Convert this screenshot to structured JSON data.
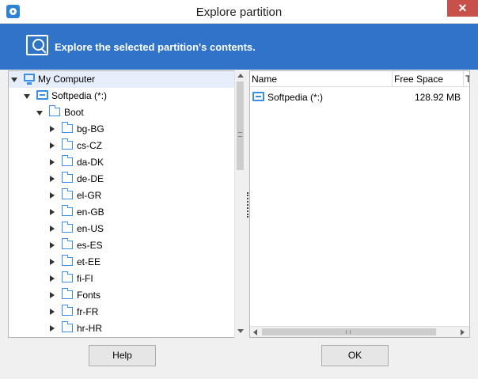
{
  "window": {
    "title": "Explore partition",
    "close_glyph": "✕"
  },
  "banner": {
    "icon": "explore-magnifier-icon",
    "text": "Explore the selected partition's contents."
  },
  "tree": {
    "root": "My Computer",
    "partition": "Softpedia (*:)",
    "boot": "Boot",
    "children": [
      "bg-BG",
      "cs-CZ",
      "da-DK",
      "de-DE",
      "el-GR",
      "en-GB",
      "en-US",
      "es-ES",
      "et-EE",
      "fi-FI",
      "Fonts",
      "fr-FR",
      "hr-HR"
    ]
  },
  "list": {
    "columns": [
      "Name",
      "Free Space",
      "T"
    ],
    "rows": [
      {
        "name": "Softpedia (*:)",
        "free_space": "128.92 MB"
      }
    ]
  },
  "buttons": {
    "help": "Help",
    "ok": "OK"
  },
  "colors": {
    "accent": "#2f74c9",
    "close": "#c7504a"
  }
}
